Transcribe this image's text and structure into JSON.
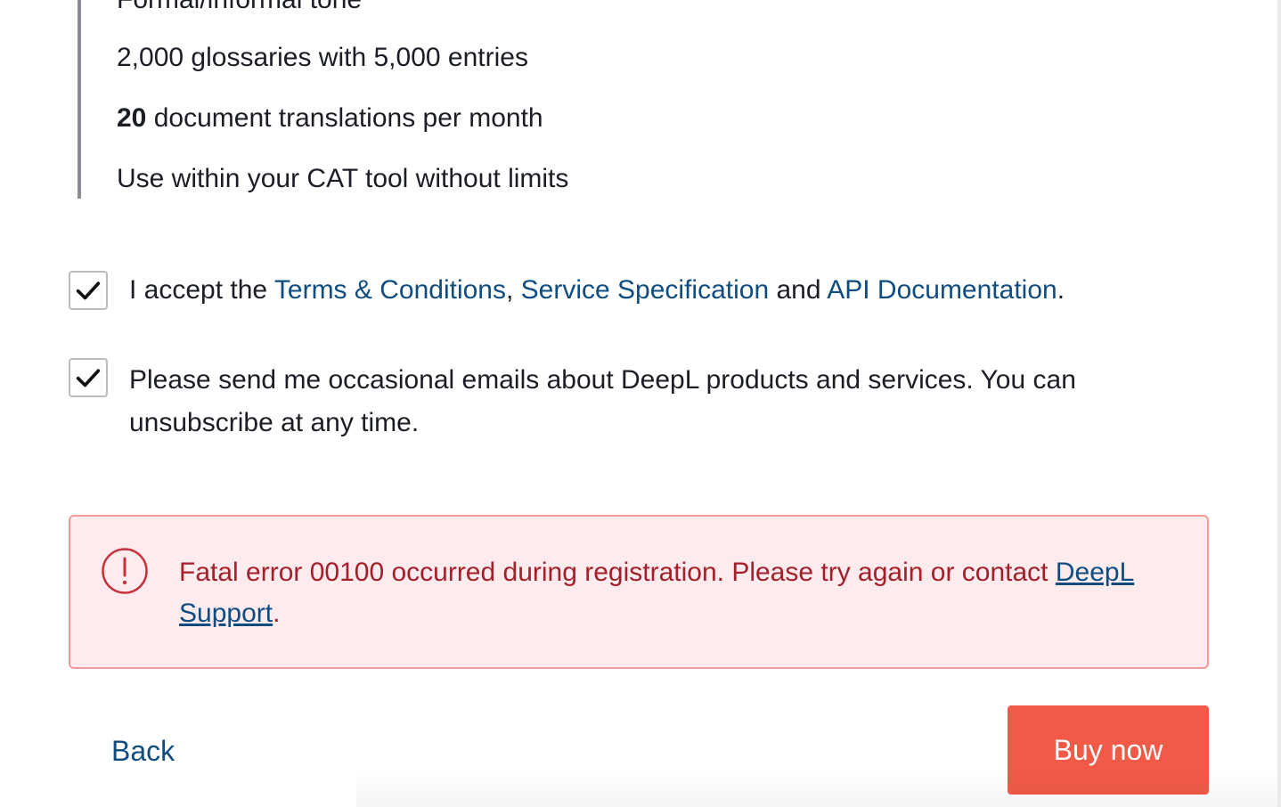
{
  "features": {
    "item_0": "Formal/informal tone",
    "item_1": "2,000 glossaries with 5,000 entries",
    "item_2_bold": "20",
    "item_2_rest": " document translations per month",
    "item_3": "Use within your CAT tool without limits"
  },
  "terms": {
    "checked": true,
    "prefix": "I accept the ",
    "link_terms": "Terms & Conditions",
    "sep": ", ",
    "link_spec": "Service Specification",
    "and": " and ",
    "link_api": "API Documentation",
    "suffix": "."
  },
  "newsletter": {
    "checked": true,
    "text": "Please send me occasional emails about DeepL products and services. You can unsubscribe at any time."
  },
  "error": {
    "icon": "exclamation-circle-icon",
    "message": "Fatal error 00100 occurred during registration. Please try again or contact ",
    "link": "DeepL Support",
    "suffix": "."
  },
  "actions": {
    "back_label": "Back",
    "buy_label": "Buy now"
  },
  "colors": {
    "link": "#0f4c81",
    "error_text": "#a3202b",
    "error_bg": "#fdebee",
    "error_border": "#f29a9a",
    "primary_button": "#f05a47"
  }
}
